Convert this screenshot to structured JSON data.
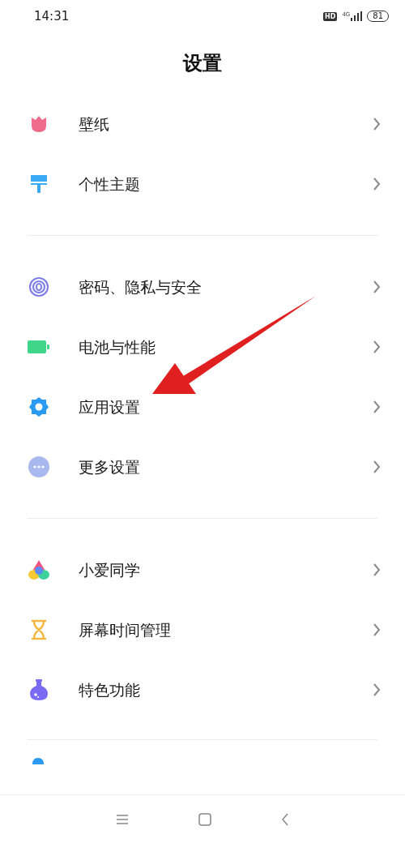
{
  "status_bar": {
    "time": "14:31",
    "hd": "HD",
    "network": "4G",
    "battery": "81"
  },
  "title": "设置",
  "sections": [
    {
      "items": [
        {
          "label": "壁纸"
        },
        {
          "label": "个性主题"
        }
      ]
    },
    {
      "items": [
        {
          "label": "密码、隐私与安全"
        },
        {
          "label": "电池与性能"
        },
        {
          "label": "应用设置"
        },
        {
          "label": "更多设置"
        }
      ]
    },
    {
      "items": [
        {
          "label": "小爱同学"
        },
        {
          "label": "屏幕时间管理"
        },
        {
          "label": "特色功能"
        }
      ]
    }
  ]
}
